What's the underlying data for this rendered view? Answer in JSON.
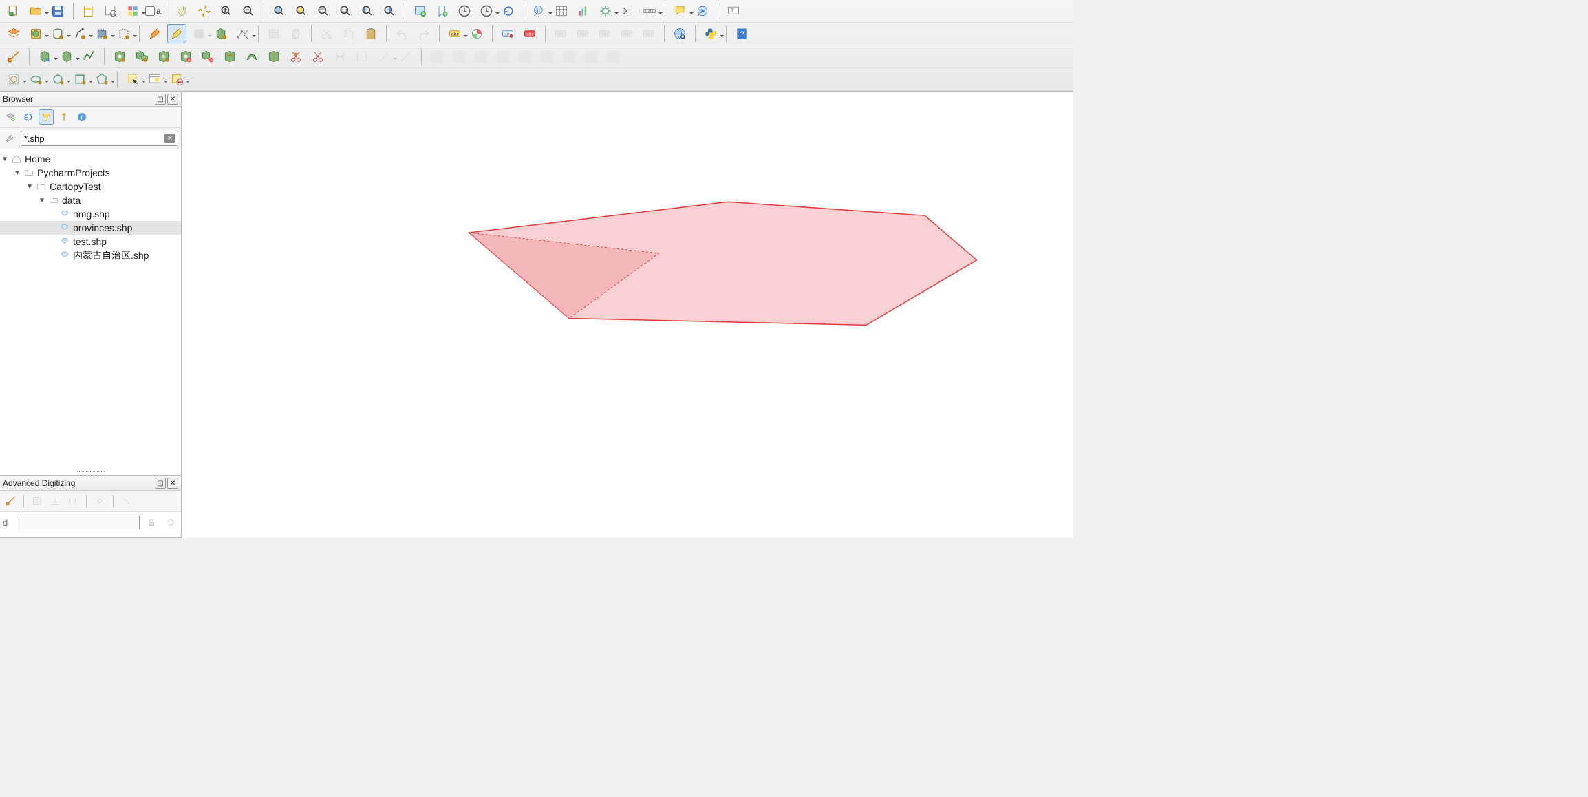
{
  "toolbar1": {
    "checkbox_label": "a"
  },
  "browser": {
    "title": "Browser",
    "filter_value": "*.shp",
    "tree": {
      "root": {
        "label": "Home"
      },
      "lvl1": {
        "label": "PycharmProjects"
      },
      "lvl2": {
        "label": "CartopyTest"
      },
      "lvl3": {
        "label": "data"
      },
      "files": [
        {
          "label": "nmg.shp"
        },
        {
          "label": "provinces.shp"
        },
        {
          "label": "test.shp"
        },
        {
          "label": "内蒙古自治区.shp"
        }
      ]
    }
  },
  "advanced_digitizing": {
    "title": "Advanced Digitizing",
    "field_label": "d"
  },
  "map": {
    "polygon_fill": "#f9d1d4",
    "polygon_stroke": "#e33a3a",
    "inner_fill": "#f3b5b8"
  }
}
